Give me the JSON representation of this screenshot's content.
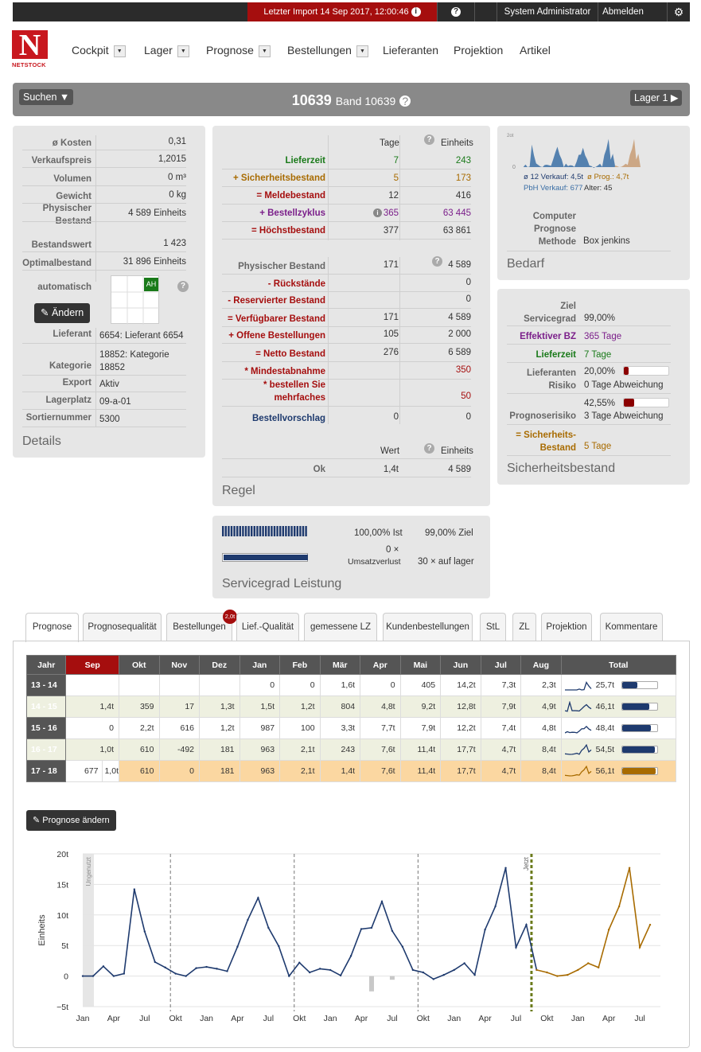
{
  "topbar": {
    "import_label": "Letzter Import 14 Sep 2017, 12:00:46",
    "help_icon": "?",
    "user": "System Administrator",
    "logout": "Abmelden",
    "settings_icon": "gear-icon"
  },
  "logo": {
    "letter": "N",
    "name": "NETSTOCK"
  },
  "nav": [
    {
      "label": "Cockpit",
      "dropdown": true
    },
    {
      "label": "Lager",
      "dropdown": true
    },
    {
      "label": "Prognose",
      "dropdown": true
    },
    {
      "label": "Bestellungen",
      "dropdown": true
    },
    {
      "label": "Lieferanten",
      "dropdown": false
    },
    {
      "label": "Projektion",
      "dropdown": false
    },
    {
      "label": "Artikel",
      "dropdown": false
    }
  ],
  "header": {
    "search_label": "Suchen ▼",
    "item_code": "10639",
    "item_name": "Band 10639",
    "location_label": "Lager 1 ▶"
  },
  "details": {
    "title": "Details",
    "rows": [
      {
        "label": "ø Kosten",
        "value": "0,31"
      },
      {
        "label": "Verkaufspreis",
        "value": "1,2015"
      },
      {
        "label": "Volumen",
        "value": "0 m³"
      },
      {
        "label": "Gewicht",
        "value": "0 kg"
      },
      {
        "label": "Physischer Bestand",
        "value": "4 589 Einheits"
      },
      {
        "label": "Bestandswert",
        "value": "1 423"
      },
      {
        "label": "Optimalbestand",
        "value": "31 896 Einheits"
      }
    ],
    "auto_label": "automatisch",
    "ah_badge": "AH",
    "edit_label": "Ändern",
    "rows2": [
      {
        "label": "Lieferant",
        "value": "6654: Lieferant 6654"
      },
      {
        "label": "Kategorie",
        "value": "18852: Kategorie 18852"
      },
      {
        "label": "Export",
        "value": "Aktiv"
      },
      {
        "label": "Lagerplatz",
        "value": "09-a-01"
      },
      {
        "label": "Sortiernummer",
        "value": "5300"
      }
    ]
  },
  "regel": {
    "title": "Regel",
    "col_tage": "Tage",
    "col_einheits": "Einheits",
    "rows": [
      {
        "label": "Lieferzeit",
        "tage": "7",
        "einheits": "243",
        "color": "green"
      },
      {
        "label": "+ Sicherheitsbestand",
        "tage": "5",
        "einheits": "173",
        "color": "orange"
      },
      {
        "label": "= Meldebestand",
        "tage": "12",
        "einheits": "416",
        "color": "red"
      },
      {
        "label": "+ Bestellzyklus",
        "tage": "365",
        "einheits": "63 445",
        "color": "purple"
      },
      {
        "label": "= Höchstbestand",
        "tage": "377",
        "einheits": "63 861",
        "color": "red"
      }
    ],
    "rows2": [
      {
        "label": "Physischer Bestand",
        "tage": "171",
        "einheits": "4 589",
        "color": "grey"
      },
      {
        "label": "- Rückstände",
        "tage": "",
        "einheits": "0",
        "color": "red"
      },
      {
        "label": "- Reservierter Bestand",
        "tage": "",
        "einheits": "0",
        "color": "red"
      },
      {
        "label": "= Verfügbarer Bestand",
        "tage": "171",
        "einheits": "4 589",
        "color": "red"
      },
      {
        "label": "+ Offene Bestellungen",
        "tage": "105",
        "einheits": "2 000",
        "color": "red"
      },
      {
        "label": "= Netto Bestand",
        "tage": "276",
        "einheits": "6 589",
        "color": "red"
      },
      {
        "label": "* Mindestabnahme",
        "tage": "",
        "einheits": "350",
        "color": "darkred"
      },
      {
        "label": "* bestellen Sie mehrfaches",
        "tage": "",
        "einheits": "50",
        "color": "darkred"
      },
      {
        "label": "Bestellvorschlag",
        "tage": "0",
        "einheits": "0",
        "color": "navy"
      }
    ],
    "col_wert": "Wert",
    "ok_label": "Ok",
    "ok_wert": "1,4t",
    "ok_einheits": "4 589"
  },
  "servicegrad": {
    "title": "Servicegrad Leistung",
    "ist": "100,00% Ist",
    "ziel": "99,00% Ziel",
    "umsatz_value": "0 ×",
    "umsatz_label": "Umsatzverlust",
    "auf_lager": "30 × auf lager",
    "level": 1.0
  },
  "bedarf": {
    "title": "Bedarf",
    "mini_axis_top": "2ot",
    "mini_axis_zero": "0",
    "verkauf": "ø 12 Verkauf: 4,5t",
    "prog": "ø Prog.: 4,7t",
    "pbh": "PbH Verkauf: 677",
    "alter": "Alter: 45",
    "method_label": "Computer Prognose Methode",
    "method_value": "Box jenkins"
  },
  "sicherheit": {
    "title": "Sicherheitsbestand",
    "ziel_label": "Ziel Servicegrad",
    "ziel_value": "99,00%",
    "eff_label": "Effektiver BZ",
    "eff_value": "365 Tage",
    "lz_label": "Lieferzeit",
    "lz_value": "7 Tage",
    "lr_label": "Lieferanten Risiko",
    "lr_value": "20,00%",
    "lr_level": 0.2,
    "lr_sub": "0 Tage Abweichung",
    "pr_label": "Prognoserisiko",
    "pr_value": "42,55%",
    "pr_level": 0.4255,
    "pr_sub": "3 Tage Abweichung",
    "sb_label": "= Sicherheits-Bestand",
    "sb_value": "5 Tage"
  },
  "tabs": [
    {
      "label": "Prognose",
      "active": true
    },
    {
      "label": "Prognosequalität"
    },
    {
      "label": "Bestellungen",
      "badge": "2,0t"
    },
    {
      "label": "Lief.-Qualität"
    },
    {
      "label": "gemessene LZ"
    },
    {
      "label": "Kundenbestellungen"
    },
    {
      "label": "StL"
    },
    {
      "label": "ZL"
    },
    {
      "label": "Projektion"
    },
    {
      "label": "Kommentare"
    }
  ],
  "grid": {
    "headers": [
      "Jahr",
      "Sep",
      "Okt",
      "Nov",
      "Dez",
      "Jan",
      "Feb",
      "Mär",
      "Apr",
      "Mai",
      "Jun",
      "Jul",
      "Aug",
      "Total"
    ],
    "rows": [
      {
        "year": "13 - 14",
        "cells": [
          "",
          "",
          "",
          "",
          "0",
          "0",
          "1,6t",
          "0",
          "405",
          "14,2t",
          "7,3t",
          "2,3t"
        ],
        "total": "25,7t",
        "fill": 0.44
      },
      {
        "year": "14 - 15",
        "cells": [
          "1,4t",
          "359",
          "17",
          "1,3t",
          "1,5t",
          "1,2t",
          "804",
          "4,8t",
          "9,2t",
          "12,8t",
          "7,9t",
          "4,9t"
        ],
        "total": "46,1t",
        "fill": 0.79
      },
      {
        "year": "15 - 16",
        "cells": [
          "0",
          "2,2t",
          "616",
          "1,2t",
          "987",
          "100",
          "3,3t",
          "7,7t",
          "7,9t",
          "12,2t",
          "7,4t",
          "4,8t"
        ],
        "total": "48,4t",
        "fill": 0.83
      },
      {
        "year": "16 - 17",
        "cells": [
          "1,0t",
          "610",
          "-492",
          "181",
          "963",
          "2,1t",
          "243",
          "7,6t",
          "11,4t",
          "17,7t",
          "4,7t",
          "8,4t"
        ],
        "total": "54,5t",
        "fill": 0.94
      },
      {
        "year": "17 - 18",
        "input": "677",
        "cells": [
          "1,0t",
          "610",
          "0",
          "181",
          "963",
          "2,1t",
          "1,4t",
          "7,6t",
          "11,4t",
          "17,7t",
          "4,7t",
          "8,4t"
        ],
        "total": "56,1t",
        "fill": 0.97
      }
    ]
  },
  "edit_forecast": "Prognose ändern",
  "chart_data": {
    "type": "line",
    "ylabel": "Einheits",
    "ylim": [
      -5,
      20
    ],
    "yticks": [
      "−5t",
      "0",
      "5t",
      "10t",
      "15t",
      "20t"
    ],
    "xticks": [
      "Jan",
      "Apr",
      "Jul",
      "Okt",
      "Jan",
      "Apr",
      "Jul",
      "Okt",
      "Jan",
      "Apr",
      "Jul",
      "Okt",
      "Jan",
      "Apr",
      "Jul",
      "Okt",
      "Jan",
      "Apr",
      "Jul"
    ],
    "annotation_unused": "Ungenutzt",
    "annotation_now": "Jetzt",
    "series": [
      {
        "values": [
          0,
          0,
          1.6,
          0,
          0.4,
          14.2,
          7.3,
          2.3,
          1.4,
          0.4,
          0,
          1.3,
          1.5,
          1.2,
          0.8,
          4.8,
          9.2,
          12.8,
          7.9,
          4.9,
          0,
          2.2,
          0.6,
          1.2,
          1.0,
          0.1,
          3.3,
          7.7,
          7.9,
          12.2,
          7.4,
          4.8,
          1.0,
          0.6,
          -0.5,
          0.2,
          1.0,
          2.1,
          0.2,
          7.6,
          11.4,
          17.7,
          4.7,
          8.4,
          1.0
        ]
      },
      {
        "values": [
          1.0,
          0.6,
          0,
          0.2,
          1.0,
          2.1,
          1.4,
          7.6,
          11.4,
          17.7,
          4.7,
          8.4
        ]
      }
    ]
  }
}
